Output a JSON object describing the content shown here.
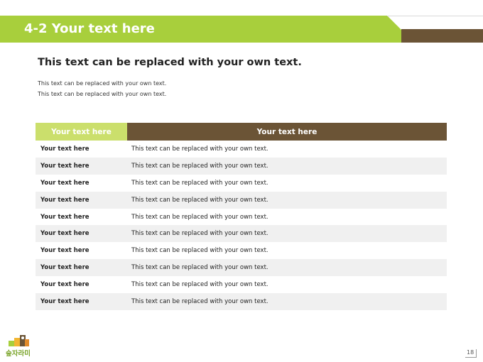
{
  "header": {
    "title": "4-2 Your text here"
  },
  "intro": {
    "heading": "This text can be replaced with your own text.",
    "lines": [
      "This text can be replaced with your own text.",
      "This text can be replaced with your own text."
    ]
  },
  "table": {
    "headers": [
      "Your text here",
      "Your text here"
    ],
    "rows": [
      [
        "Your text here",
        "This text can be replaced with your own text."
      ],
      [
        "Your text here",
        "This text can be replaced with your own text."
      ],
      [
        "Your text here",
        "This text can be replaced with your own text."
      ],
      [
        "Your text here",
        "This text can be replaced with your own text."
      ],
      [
        "Your text here",
        "This text can be replaced with your own text."
      ],
      [
        "Your text here",
        "This text can be replaced with your own text."
      ],
      [
        "Your text here",
        "This text can be replaced with your own text."
      ],
      [
        "Your text here",
        "This text can be replaced with your own text."
      ],
      [
        "Your text here",
        "This text can be replaced with your own text."
      ],
      [
        "Your text here",
        "This text can be replaced with your own text."
      ]
    ]
  },
  "footer": {
    "logo_text": "숲자라미",
    "page_number": "18"
  },
  "colors": {
    "accent_green": "#a8cf3c",
    "light_green": "#cbdf6c",
    "brown": "#6b5436",
    "row_alt": "#f0f0f0"
  }
}
